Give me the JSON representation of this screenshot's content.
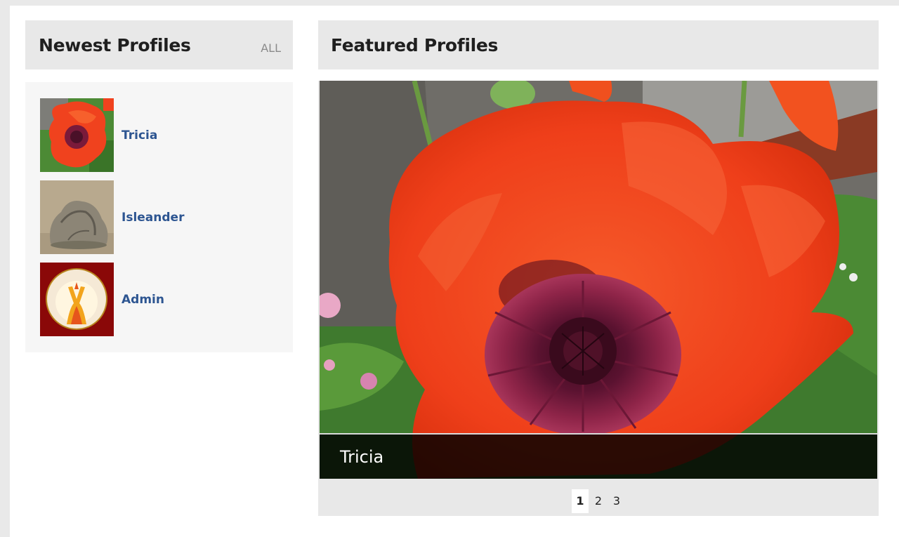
{
  "newest": {
    "title": "Newest Profiles",
    "all_label": "ALL",
    "profiles": [
      {
        "name": "Tricia"
      },
      {
        "name": "Isleander"
      },
      {
        "name": "Admin"
      }
    ]
  },
  "featured": {
    "title": "Featured Profiles",
    "caption": "Tricia",
    "pages": [
      "1",
      "2",
      "3"
    ],
    "active_page": "1"
  },
  "colors": {
    "link": "#2d5591",
    "header_bg": "#e8e8e8",
    "poppy": "#f0421e"
  }
}
